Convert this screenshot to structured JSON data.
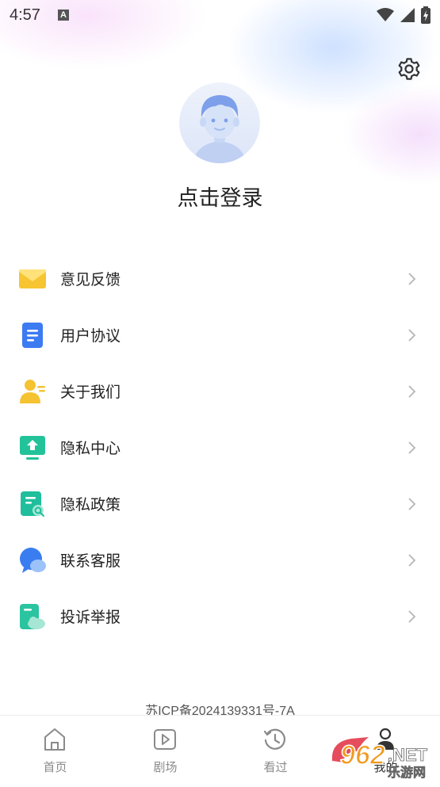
{
  "status_bar": {
    "time": "4:57",
    "notif_letter": "A"
  },
  "profile": {
    "login_label": "点击登录"
  },
  "menu": {
    "items": [
      {
        "id": "feedback",
        "label": "意见反馈",
        "icon": "mail-icon"
      },
      {
        "id": "user-agreement",
        "label": "用户协议",
        "icon": "document-icon"
      },
      {
        "id": "about",
        "label": "关于我们",
        "icon": "person-icon"
      },
      {
        "id": "privacy-center",
        "label": "隐私中心",
        "icon": "monitor-upload-icon"
      },
      {
        "id": "privacy-policy",
        "label": "隐私政策",
        "icon": "policy-icon"
      },
      {
        "id": "customer-service",
        "label": "联系客服",
        "icon": "chat-bubble-icon"
      },
      {
        "id": "report",
        "label": "投诉举报",
        "icon": "report-icon"
      }
    ]
  },
  "footer": {
    "icp": "苏ICP备2024139331号-7A"
  },
  "tabbar": {
    "tabs": [
      {
        "label": "首页",
        "icon": "home-icon"
      },
      {
        "label": "剧场",
        "icon": "play-icon"
      },
      {
        "label": "看过",
        "icon": "history-icon"
      },
      {
        "label": "我的",
        "icon": "profile-icon"
      }
    ]
  },
  "watermark": {
    "number": "962",
    "suffix": ".NET",
    "text": "乐游网"
  },
  "colors": {
    "mail": "#F7C532",
    "document": "#3C7BF2",
    "person": "#F5C231",
    "monitor": "#23C39A",
    "policy": "#1FBE9C",
    "chat": "#3A7DF0",
    "report": "#2BC4A0",
    "watermark_orange": "#F29A1E",
    "watermark_red": "#E23A4B"
  }
}
